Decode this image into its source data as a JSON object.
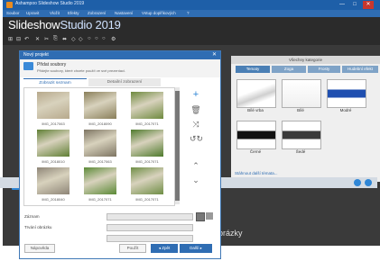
{
  "window": {
    "title": "Ashampoo Slideshow Studio 2019",
    "controls": [
      "—",
      "□",
      "✕"
    ]
  },
  "menu": [
    "Soubor",
    "Upravit",
    "Vložit",
    "Efekty",
    "Zobrazení",
    "Nastavení",
    "Vstup doplňkových",
    "?"
  ],
  "logo": {
    "part1": "Slideshow",
    "part2": "Studio 2019"
  },
  "toolbar_icons": [
    "⊞",
    "⊟",
    "↶",
    "✕",
    "✂",
    "⎘",
    "⬌",
    "◇",
    "◇",
    "○",
    "○",
    "○",
    "⚙"
  ],
  "side_panel": {
    "header": "Všechny kategorie",
    "tabs": [
      "Tematy",
      "Zoga",
      "Frosty",
      "Hudební efekt"
    ],
    "thumbs": [
      {
        "label": "Bílé vrba",
        "style": "white-cloth"
      },
      {
        "label": "Bílé",
        "style": "white"
      },
      {
        "label": "Modré",
        "style": "blue"
      },
      {
        "label": "Černé",
        "style": "black"
      },
      {
        "label": "Šedé",
        "style": "gray"
      }
    ],
    "link": "Stáhnout další témata..."
  },
  "bottom_text": "brázky",
  "dialog": {
    "title": "Nový projekt",
    "heading": "Přidat soubory",
    "subheading": "Přidejte soubory, které chcete použít ve své prezentaci.",
    "tabs": [
      "Zobrazit seznam",
      "Detailní zobrazení"
    ],
    "photos": [
      {
        "label": "IMG_2017063",
        "tone": "#b7a98c"
      },
      {
        "label": "IMG_2018090",
        "tone": "#8a7f5a"
      },
      {
        "label": "IMG_2017071",
        "tone": "#6e8a3e"
      },
      {
        "label": "IMG_2018010",
        "tone": "#5f7f34"
      },
      {
        "label": "IMG_2017063",
        "tone": "#7d7462"
      },
      {
        "label": "IMG_2017071",
        "tone": "#4e7a2c"
      },
      {
        "label": "IMG_2018040",
        "tone": "#8e8577"
      },
      {
        "label": "IMG_2017071",
        "tone": "#5b8a36"
      },
      {
        "label": "IMG_2017071",
        "tone": "#6f8e45"
      }
    ],
    "side_icons": [
      "+",
      "🗑",
      "⤨",
      "↺↻",
      "⌃",
      "⌄"
    ],
    "fields": [
      {
        "label": "Záznam",
        "value": ""
      },
      {
        "label": "Trvání obrázku",
        "value": ""
      },
      {
        "label": "",
        "value": ""
      }
    ],
    "buttons": {
      "help": "Nápověda",
      "finish": "Použít",
      "back": "◂ Zpět",
      "next": "Další ▸"
    }
  }
}
